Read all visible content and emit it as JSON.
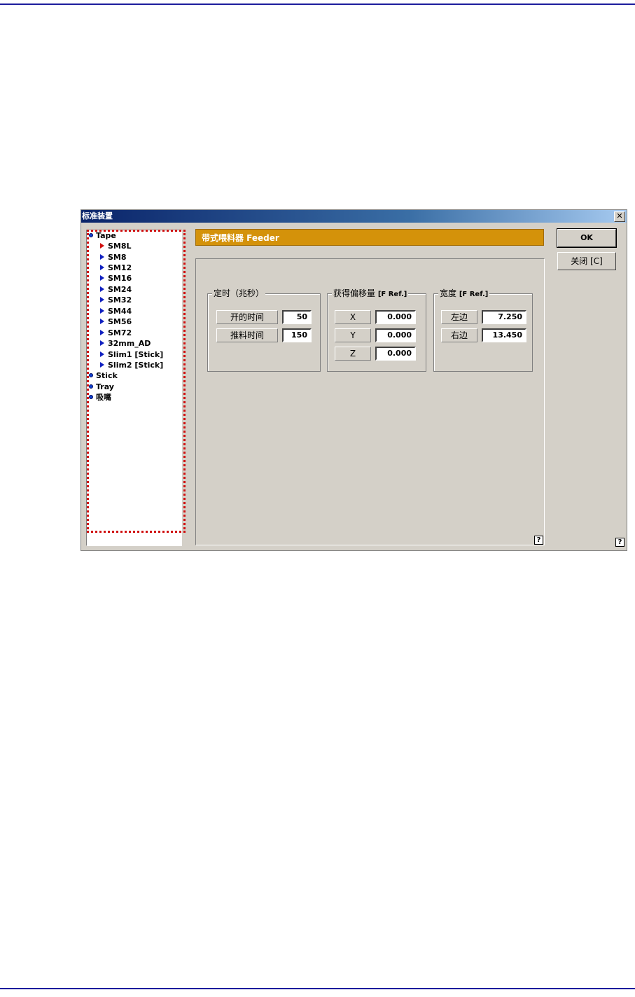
{
  "window": {
    "title": "标准装置",
    "close_glyph": "✕",
    "help_glyph": "?"
  },
  "tree": {
    "roots": [
      {
        "label": "Tape",
        "icon": "node-dot-icon"
      },
      {
        "label": "Stick",
        "icon": "node-dot-icon"
      },
      {
        "label": "Tray",
        "icon": "node-dot-icon"
      },
      {
        "label": "吸嘴",
        "icon": "node-dot-icon"
      }
    ],
    "tape_children": [
      {
        "label": "SM8L",
        "selected": true
      },
      {
        "label": "SM8"
      },
      {
        "label": "SM12"
      },
      {
        "label": "SM16"
      },
      {
        "label": "SM24"
      },
      {
        "label": "SM32"
      },
      {
        "label": "SM44"
      },
      {
        "label": "SM56"
      },
      {
        "label": "SM72"
      },
      {
        "label": "32mm_AD"
      },
      {
        "label": "Slim1 [Stick]"
      },
      {
        "label": "Slim2 [Stick]"
      }
    ]
  },
  "banner": {
    "title": "带式喂料器 Feeder",
    "color": "#d4920a"
  },
  "timing": {
    "title": "定时（兆秒）",
    "open_label": "开的时间",
    "open_value": "50",
    "push_label": "推料时间",
    "push_value": "150"
  },
  "offset": {
    "title": "获得偏移量",
    "title_suffix": "[F Ref.]",
    "x_label": "X",
    "x_value": "0.000",
    "y_label": "Y",
    "y_value": "0.000",
    "z_label": "Z",
    "z_value": "0.000"
  },
  "width": {
    "title": "宽度",
    "title_suffix": "[F Ref.]",
    "left_label": "左边",
    "left_value": "7.250",
    "right_label": "右边",
    "right_value": "13.450"
  },
  "buttons": {
    "ok": "OK",
    "close": "关闭 [C]"
  }
}
